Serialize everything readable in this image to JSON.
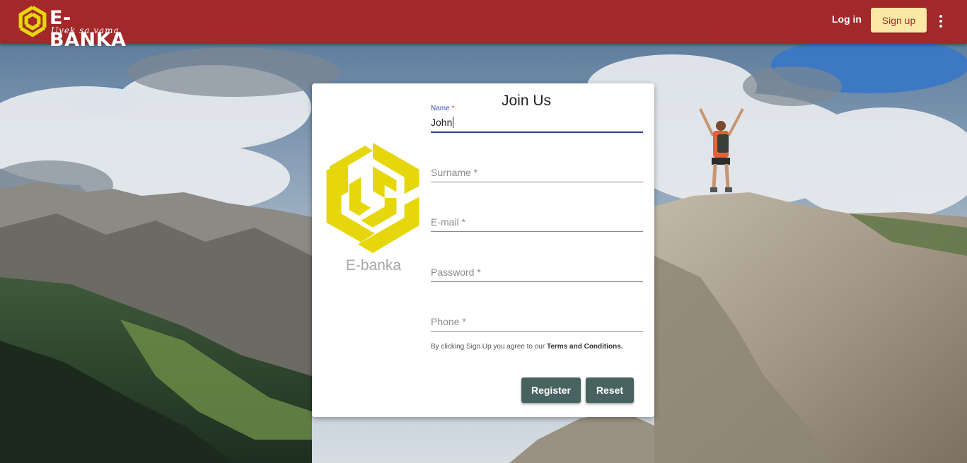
{
  "colors": {
    "header_bg": "#a3282a",
    "signup_bg": "#fbe7a6",
    "logo_yellow": "#e6d60c",
    "button_bg": "#48625f",
    "focus_underline": "#2f3d97"
  },
  "header": {
    "brand_name": "E-BANKA",
    "brand_tagline": "Uvek sa vama",
    "login_label": "Log in",
    "signup_label": "Sign up",
    "more_icon": "more-vert-icon"
  },
  "card": {
    "logo_text": "E-banka",
    "title": "Join Us",
    "fields": {
      "name": {
        "label": "Name",
        "required_mark": "*",
        "value": "John"
      },
      "surname": {
        "label": "Surname *",
        "value": ""
      },
      "email": {
        "label": "E-mail *",
        "value": ""
      },
      "password": {
        "label": "Password *",
        "value": ""
      },
      "phone": {
        "label": "Phone *",
        "value": ""
      }
    },
    "terms_prefix": "By clicking Sign Up you agree to our ",
    "terms_link": "Terms and Conditions.",
    "register_label": "Register",
    "reset_label": "Reset"
  }
}
